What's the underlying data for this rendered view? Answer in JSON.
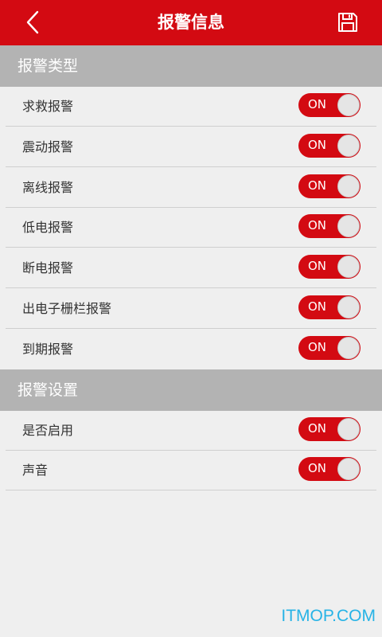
{
  "header": {
    "title": "报警信息",
    "back_icon": "chevron-left-icon",
    "save_icon": "floppy-disk-icon"
  },
  "sections": [
    {
      "title": "报警类型",
      "items": [
        {
          "label": "求救报警",
          "state": "ON"
        },
        {
          "label": "震动报警",
          "state": "ON"
        },
        {
          "label": "离线报警",
          "state": "ON"
        },
        {
          "label": "低电报警",
          "state": "ON"
        },
        {
          "label": "断电报警",
          "state": "ON"
        },
        {
          "label": "出电子栅栏报警",
          "state": "ON"
        },
        {
          "label": "到期报警",
          "state": "ON"
        }
      ]
    },
    {
      "title": "报警设置",
      "items": [
        {
          "label": "是否启用",
          "state": "ON"
        },
        {
          "label": "声音",
          "state": "ON"
        }
      ]
    }
  ],
  "watermark": "ITMOP.COM",
  "colors": {
    "brand_red": "#d30a12",
    "section_gray": "#b3b3b3",
    "background": "#efefef",
    "watermark_blue": "#27b3e6"
  }
}
